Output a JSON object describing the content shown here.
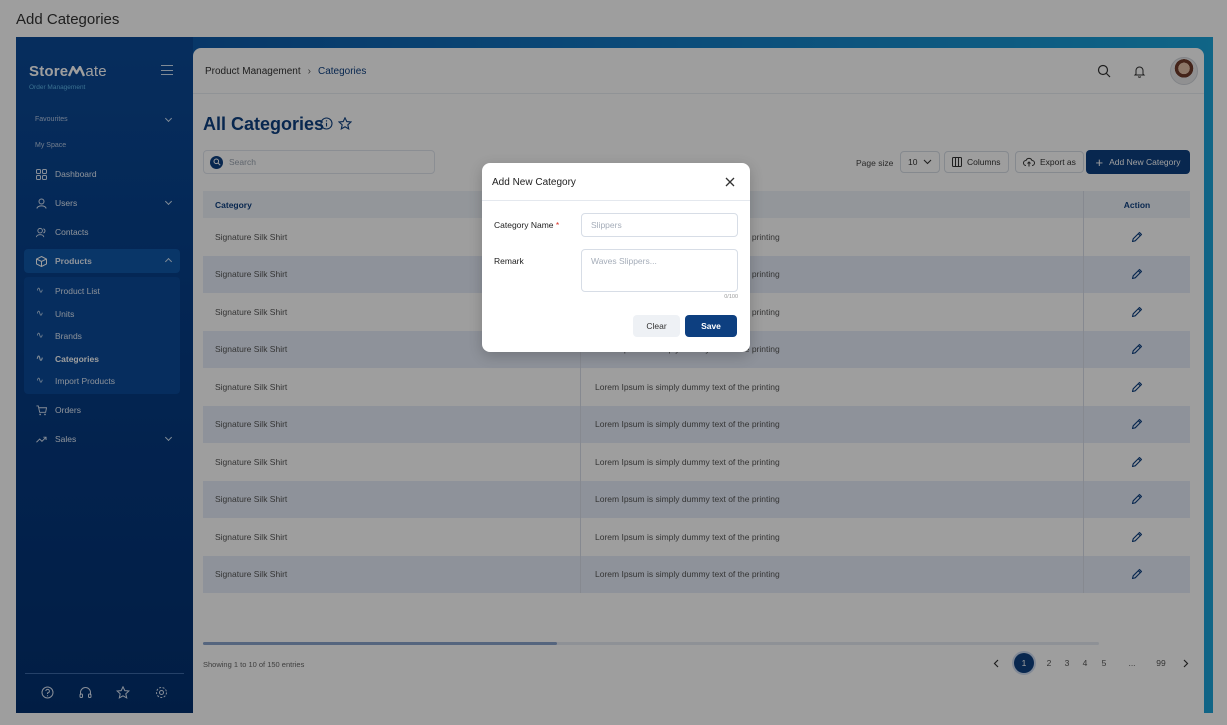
{
  "window": {
    "title": "Add Categories"
  },
  "sidebar": {
    "brand_bold": "Store",
    "brand_light": "ate",
    "brand_sub": "Order Management",
    "favourites": "Favourites",
    "my_space": "My Space",
    "items": [
      {
        "label": "Dashboard"
      },
      {
        "label": "Users"
      },
      {
        "label": "Contacts"
      },
      {
        "label": "Products"
      },
      {
        "label": "Orders"
      },
      {
        "label": "Sales"
      }
    ],
    "product_subitems": [
      {
        "label": "Product List"
      },
      {
        "label": "Units"
      },
      {
        "label": "Brands"
      },
      {
        "label": "Categories"
      },
      {
        "label": "Import Products"
      }
    ]
  },
  "header": {
    "breadcrumb": [
      "Product Management",
      "Categories"
    ]
  },
  "main": {
    "title": "All Categories",
    "search_placeholder": "Search",
    "page_size_label": "Page size",
    "page_size_value": "10",
    "columns_label": "Columns",
    "export_label": "Export as",
    "add_button_label": "Add New Category",
    "table": {
      "headers": [
        "Category",
        "",
        "Action"
      ],
      "rows": [
        {
          "category": "Signature Silk Shirt",
          "remark": "Lorem Ipsum is simply dummy text of the printing"
        },
        {
          "category": "Signature Silk Shirt",
          "remark": "Lorem Ipsum is simply dummy text of the printing"
        },
        {
          "category": "Signature Silk Shirt",
          "remark": "Lorem Ipsum is simply dummy text of the printing"
        },
        {
          "category": "Signature Silk Shirt",
          "remark": "Lorem Ipsum is simply dummy text of the printing"
        },
        {
          "category": "Signature Silk Shirt",
          "remark": "Lorem Ipsum is simply dummy text of the printing"
        },
        {
          "category": "Signature Silk Shirt",
          "remark": "Lorem Ipsum is simply dummy text of the printing"
        },
        {
          "category": "Signature Silk Shirt",
          "remark": "Lorem Ipsum is simply dummy text of the printing"
        },
        {
          "category": "Signature Silk Shirt",
          "remark": "Lorem Ipsum is simply dummy text of the printing"
        },
        {
          "category": "Signature Silk Shirt",
          "remark": "Lorem Ipsum is simply dummy text of the printing"
        },
        {
          "category": "Signature Silk Shirt",
          "remark": "Lorem Ipsum is simply dummy text of the printing"
        }
      ]
    },
    "showing": "Showing 1 to 10 of 150 entries",
    "pagination": {
      "pages": [
        "1",
        "2",
        "3",
        "4",
        "5",
        "...",
        "99"
      ],
      "current": "1"
    }
  },
  "modal": {
    "title": "Add New Category",
    "name_label": "Category Name",
    "required_mark": "*",
    "name_placeholder": "Slippers",
    "remark_label": "Remark",
    "remark_placeholder": "Waves Slippers...",
    "counter": "0/100",
    "clear_label": "Clear",
    "save_label": "Save"
  },
  "colors": {
    "primary": "#0d3f80",
    "sidebar_top": "#0b4a97",
    "row_alt": "#e5ecf8",
    "overlay": "rgba(0,0,0,0.38)"
  }
}
